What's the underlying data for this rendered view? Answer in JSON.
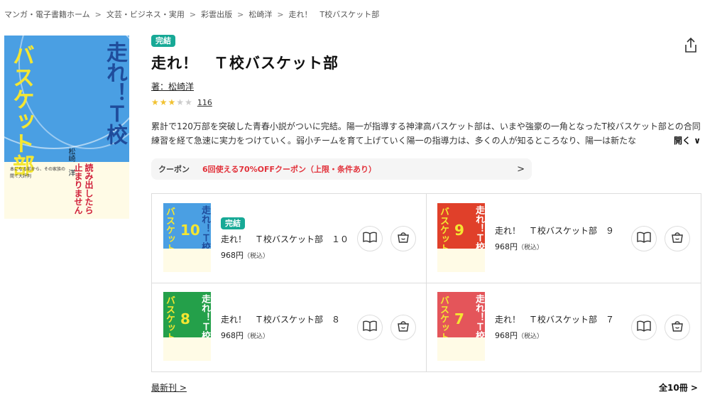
{
  "breadcrumb": [
    "マンガ・電子書籍ホーム",
    "文芸・ビジネス・実用",
    "彩雲出版",
    "松崎洋",
    "走れ！　T校バスケット部"
  ],
  "breadcrumb_sep": ">",
  "book": {
    "status_badge": "完結",
    "title": "走れ！　Ｔ校バスケット部",
    "author": "著：松崎洋",
    "rating_stars": 3,
    "rating_max": 5,
    "review_count": "116",
    "description": "累計で120万部を突破した青春小説がついに完結。陽一が指導する神津高バスケット部は、いまや強豪の一角となったT校バスケット部との合同練習を経て急速に実力をつけていく。弱小チームを育て上げていく陽一の指導力は、多くの人が知るところなり、陽一は新たな",
    "more_label": "開く",
    "cover": {
      "title_blue": "走れ！Ｔ校",
      "title_yellow": "バスケット部",
      "author": "松崎　洋",
      "obi": "読み出したら止まりません",
      "obi_small": "本になる前から、その家族の間で大評判"
    }
  },
  "coupon": {
    "label": "クーポン",
    "text": "6回使える70%OFFクーポン（上限・条件あり）",
    "chevron": ">"
  },
  "volumes": [
    {
      "num": "10",
      "title": "走れ！　Ｔ校バスケット部　１０",
      "price": "968円",
      "tax": "（税込）",
      "badge": "完結",
      "color": "#4a9fe3",
      "tcolor": "#1f4c9b"
    },
    {
      "num": "9",
      "title": "走れ！　Ｔ校バスケット部　９",
      "price": "968円",
      "tax": "（税込）",
      "badge": "",
      "color": "#e0402a",
      "tcolor": "#ffffff"
    },
    {
      "num": "8",
      "title": "走れ！　Ｔ校バスケット部　８",
      "price": "968円",
      "tax": "（税込）",
      "badge": "",
      "color": "#24a04a",
      "tcolor": "#ffffff"
    },
    {
      "num": "7",
      "title": "走れ！　Ｔ校バスケット部　７",
      "price": "968円",
      "tax": "（税込）",
      "badge": "",
      "color": "#e4555a",
      "tcolor": "#ffffff"
    }
  ],
  "footer": {
    "latest": "最新刊",
    "total": "全10冊",
    "chevron": ">"
  },
  "colors": {
    "badge": "#17a996",
    "coupon_text": "#e2323b",
    "star_on": "#f1c232",
    "star_off": "#cccccc"
  }
}
